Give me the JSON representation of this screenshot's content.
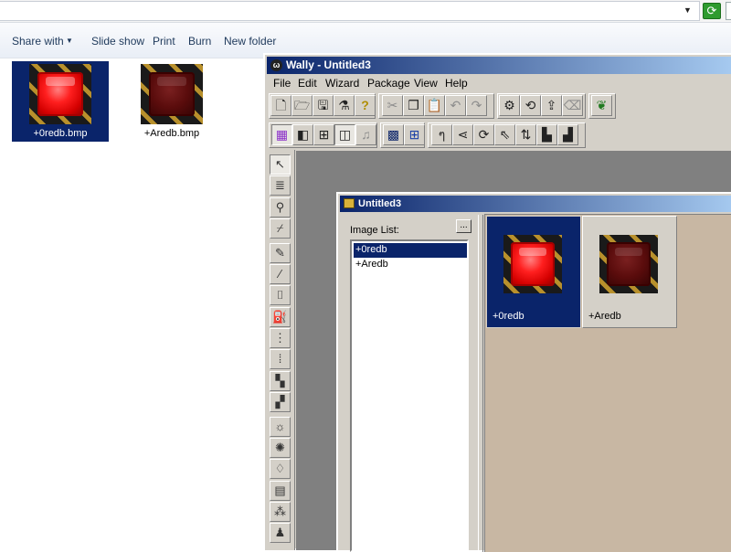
{
  "explorer": {
    "toolbar": {
      "share_with": "Share with",
      "slide_show": "Slide show",
      "print": "Print",
      "burn": "Burn",
      "new_folder": "New folder"
    },
    "files": [
      {
        "name": "+0redb.bmp",
        "selected": true,
        "state": "lit"
      },
      {
        "name": "+Aredb.bmp",
        "selected": false,
        "state": "dark"
      }
    ]
  },
  "wally": {
    "title": "Wally - Untitled3",
    "menu": [
      "File",
      "Edit",
      "Wizard",
      "Package",
      "View",
      "Help"
    ],
    "toolbar_row1_icons": [
      "new-file-icon",
      "open-folder-icon",
      "save-icon",
      "wizard-icon",
      "help-icon",
      "cut-icon",
      "copy-icon",
      "paste-icon",
      "undo-icon",
      "redo-icon",
      "package-add-icon",
      "package-refresh-icon",
      "package-export-icon",
      "package-remove-icon",
      "plant-icon"
    ],
    "toolbar_row2_icons": [
      "palette-icon",
      "image-view-icon",
      "grid-view-icon",
      "thumbnail-view-icon",
      "music-icon",
      "blue-grid-icon",
      "blue-grid-lines-icon",
      "swirl-icon",
      "shear-icon",
      "rotate-icon",
      "arrow-icon",
      "flip-icon",
      "align-left-icon",
      "align-right-icon"
    ],
    "tools": [
      "pointer-icon",
      "ruler-icon",
      "magnifier-icon",
      "eyedropper-icon",
      "pencil-icon",
      "brush-icon",
      "eraser-icon",
      "fill-bucket-icon",
      "spray-icon",
      "spray-large-icon",
      "dither-icon",
      "dither-large-icon",
      "brightness-icon",
      "sun-icon",
      "drop-icon",
      "gradient-icon",
      "texture-icon",
      "stamp-icon"
    ],
    "child_window": {
      "title": "Untitled3",
      "list_label": "Image List:",
      "list_more": "...",
      "list_items": [
        {
          "name": "+0redb",
          "selected": true
        },
        {
          "name": "+Aredb",
          "selected": false
        }
      ],
      "tiles": [
        {
          "name": "+0redb",
          "selected": true,
          "state": "lit"
        },
        {
          "name": "+Aredb",
          "selected": false,
          "state": "dark"
        }
      ]
    }
  },
  "colors": {
    "selection": "#0a246a",
    "title_gradient_start": "#0a246a",
    "title_gradient_end": "#a6caf0",
    "thumb_pane_bg": "#c8b7a3",
    "window_face": "#d4d0c8"
  }
}
